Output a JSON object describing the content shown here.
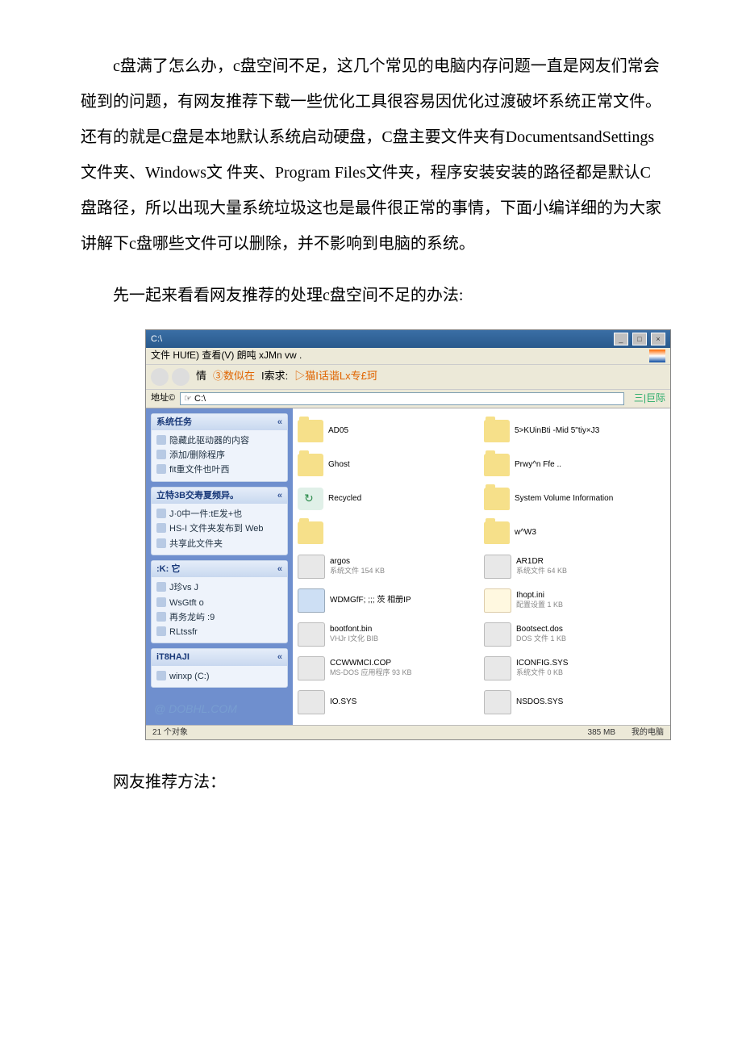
{
  "paragraphs": {
    "p1": "c盘满了怎么办，c盘空间不足，这几个常见的电脑内存问题一直是网友们常会碰到的问题，有网友推荐下载一些优化工具很容易因优化过渡破坏系统正常文件。还有的就是C盘是本地默认系统启动硬盘，C盘主要文件夹有DocumentsandSettings文件夹、Windows文 件夹、Program Files文件夹，程序安装安装的路径都是默认C盘路径，所以出现大量系统垃圾这也是最件很正常的事情，下面小编详细的为大家讲解下c盘哪些文件可以删除，并不影响到电脑的系统。",
    "p2": "先一起来看看网友推荐的处理c盘空间不足的办法:",
    "p3": "网友推荐方法："
  },
  "win": {
    "title": "C:\\",
    "menu": "文件  HUfE)  查看(V)    朗吨  xJMn vw .",
    "toolbar_left": "情",
    "toolbar_mid": " ③数似在",
    "toolbar_search_label": "I索求:",
    "toolbar_right": "▷猫I话谐Lx专£珂",
    "addr_label": "地址©",
    "addr_value": "☞ C:\\",
    "go_label": "三|巨际",
    "status_left": "21 个对象",
    "status_mid": "385 MB",
    "status_right": "我的电脑",
    "watermark": "@ DOBHL.COM"
  },
  "side": {
    "panels": [
      {
        "title": "系统任务",
        "items": [
          "隐藏此驱动器的内容",
          "添加/删除程序",
          "fit重文件也叶西"
        ]
      },
      {
        "title": "立特3B交寿夏频异。",
        "items": [
          "J·0中一件:tE发+也",
          "HS‑I     文件夹发布到   Web",
          "共享此文件夹"
        ]
      },
      {
        "title": ":K:  它",
        "items": [
          "J珍vs  J",
          "WsGtft o",
          "再务龙屿 :9",
          "RLtssfr"
        ]
      },
      {
        "title": "iT8HAJI",
        "items": [
          "winxp (C:)"
        ]
      }
    ]
  },
  "files": [
    {
      "icon": "folder",
      "name": "AD05",
      "meta": ""
    },
    {
      "icon": "folder",
      "name": "5>KUinBti ‑Mid 5\"tiy×J3",
      "meta": ""
    },
    {
      "icon": "folder",
      "name": "Ghost",
      "meta": ""
    },
    {
      "icon": "folder",
      "name": "Prwy^n Ffe ..",
      "meta": ""
    },
    {
      "icon": "rec",
      "name": "Recycled",
      "meta": ""
    },
    {
      "icon": "folder",
      "name": "System Volume Information",
      "meta": ""
    },
    {
      "icon": "folder",
      "name": "",
      "meta": ""
    },
    {
      "icon": "folder",
      "name": "w^W3",
      "meta": ""
    },
    {
      "icon": "sys",
      "name": "argos",
      "meta": "系统文件\n154 KB"
    },
    {
      "icon": "sys",
      "name": "AR1DR",
      "meta": "系统文件\n64 KB"
    },
    {
      "icon": "img",
      "name": "WDMGfF;   ;;;   茨     相册IP",
      "meta": ""
    },
    {
      "icon": "ini",
      "name": "Ihopt.ini",
      "meta": "配置设置\n1 KB"
    },
    {
      "icon": "sys",
      "name": "bootfont.bin",
      "meta": "VHJr I文化\nBIB"
    },
    {
      "icon": "sys",
      "name": "Bootsect.dos",
      "meta": "DOS 文件\n1 KB"
    },
    {
      "icon": "sys",
      "name": "CCWWMCI.COP",
      "meta": "MS‑DOS 应用程序\n93 KB"
    },
    {
      "icon": "sys",
      "name": "ICONFIG.SYS",
      "meta": "系统文件\n0 KB"
    },
    {
      "icon": "sys",
      "name": "IO.SYS",
      "meta": ""
    },
    {
      "icon": "sys",
      "name": "NSDOS.SYS",
      "meta": ""
    }
  ]
}
